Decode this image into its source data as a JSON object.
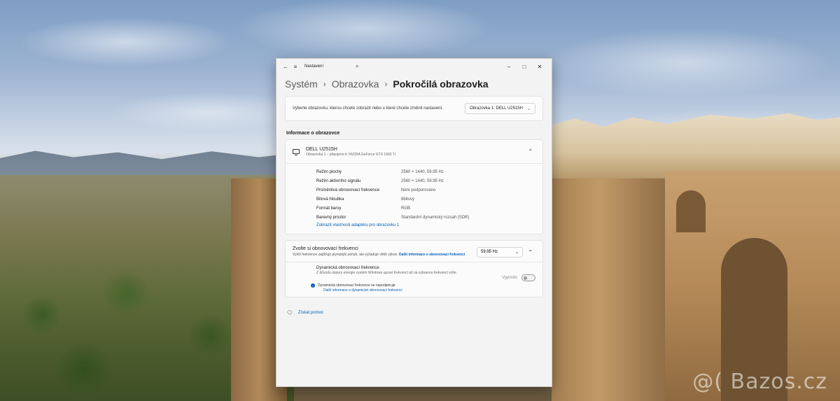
{
  "window": {
    "app_title": "Nastavení",
    "icons": {
      "back": "back-arrow-icon",
      "menu": "hamburger-menu-icon",
      "search": "search-icon",
      "minimize": "minimize-icon",
      "maximize": "maximize-icon",
      "close": "close-icon"
    }
  },
  "breadcrumb": [
    "Systém",
    "Obrazovka",
    "Pokročilá obrazovka"
  ],
  "display_select": {
    "description": "Vyberte obrazovku, kterou chcete zobrazit nebo u které chcete změnit nastavení.",
    "value": "Obrazovka 1: DELL U2515H"
  },
  "info_section": {
    "title": "Informace o obrazovce",
    "monitor_name": "DELL U2515H",
    "monitor_sub": "Obrazovka 1 – připojeno k: NVIDIA GeForce GTX 1660 Ti",
    "rows": [
      {
        "label": "Režim plochy",
        "value": "2560 × 1440, 59.95 Hz"
      },
      {
        "label": "Režim aktivního signálu",
        "value": "2560 × 1440, 59.95 Hz"
      },
      {
        "label": "Proměnlivá obnovovací frekvence",
        "value": "Není podporováno"
      },
      {
        "label": "Bitová hloubka",
        "value": "8bitový"
      },
      {
        "label": "Formát barvy",
        "value": "RGB"
      },
      {
        "label": "Barevný prostor",
        "value": "Standardní dynamický rozsah (SDR)"
      }
    ],
    "adapter_link": "Zobrazit vlastnosti adaptéru pro obrazovku 1"
  },
  "refresh": {
    "title": "Zvolte si obnovovací frekvenci",
    "description": "Vyšší frekvence zajišťuje plynulejší pohyb, ale vyžaduje větší výkon.",
    "more_link": "Další informace o obnovovací frekvenci",
    "value": "59.95 Hz",
    "dynamic_title": "Dynamická obnovovací frekvence",
    "dynamic_desc": "Z důvodu úspory energie systém Windows upraví frekvenci až na vybranou frekvenci výše.",
    "toggle_label": "Vypnuto",
    "toggle_on": false,
    "note": "Dynamická obnovovací frekvence se nepodporuje",
    "note_link": "Další informace o dynamické obnovovací frekvenci"
  },
  "help": {
    "label": "Získat pomoc"
  },
  "watermark": "@( Bazos.cz",
  "colors": {
    "accent": "#005fb8",
    "window_bg": "#f3f3f3",
    "card_bg": "#fbfbfb"
  }
}
